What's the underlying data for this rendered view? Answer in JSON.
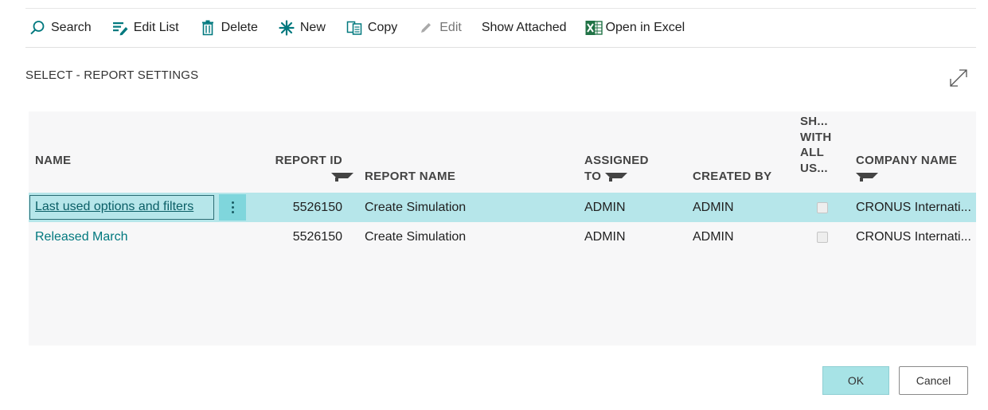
{
  "toolbar": {
    "search": {
      "label": "Search",
      "icon": "search-icon"
    },
    "edit_list": {
      "label": "Edit List",
      "icon": "edit-list-icon"
    },
    "delete": {
      "label": "Delete",
      "icon": "trash-icon"
    },
    "new": {
      "label": "New",
      "icon": "new-icon"
    },
    "copy": {
      "label": "Copy",
      "icon": "copy-icon"
    },
    "edit": {
      "label": "Edit",
      "icon": "pencil-icon",
      "disabled": true
    },
    "show_attached": {
      "label": "Show Attached"
    },
    "open_in_excel": {
      "label": "Open in Excel",
      "icon": "excel-icon"
    }
  },
  "page": {
    "title": "SELECT - REPORT SETTINGS"
  },
  "grid": {
    "columns": {
      "name": "NAME",
      "report_id": "REPORT ID",
      "report_name": "REPORT NAME",
      "assigned_to": "ASSIGNED TO",
      "created_by": "CREATED BY",
      "shared_l1": "SH...",
      "shared_l2": "WITH",
      "shared_l3": "ALL",
      "shared_l4": "US...",
      "company_name": "COMPANY NAME"
    },
    "rows": [
      {
        "name": "Last used options and filters",
        "report_id": "5526150",
        "report_name": "Create Simulation",
        "assigned_to": "ADMIN",
        "created_by": "ADMIN",
        "shared": false,
        "company_name": "CRONUS Internati..."
      },
      {
        "name": "Released March",
        "report_id": "5526150",
        "report_name": "Create Simulation",
        "assigned_to": "ADMIN",
        "created_by": "ADMIN",
        "shared": false,
        "company_name": "CRONUS Internati..."
      }
    ]
  },
  "footer": {
    "ok_label": "OK",
    "cancel_label": "Cancel"
  },
  "colors": {
    "accent": "#00787e",
    "selected_row": "#b6e6ea",
    "ok_button": "#a7e3e6"
  }
}
